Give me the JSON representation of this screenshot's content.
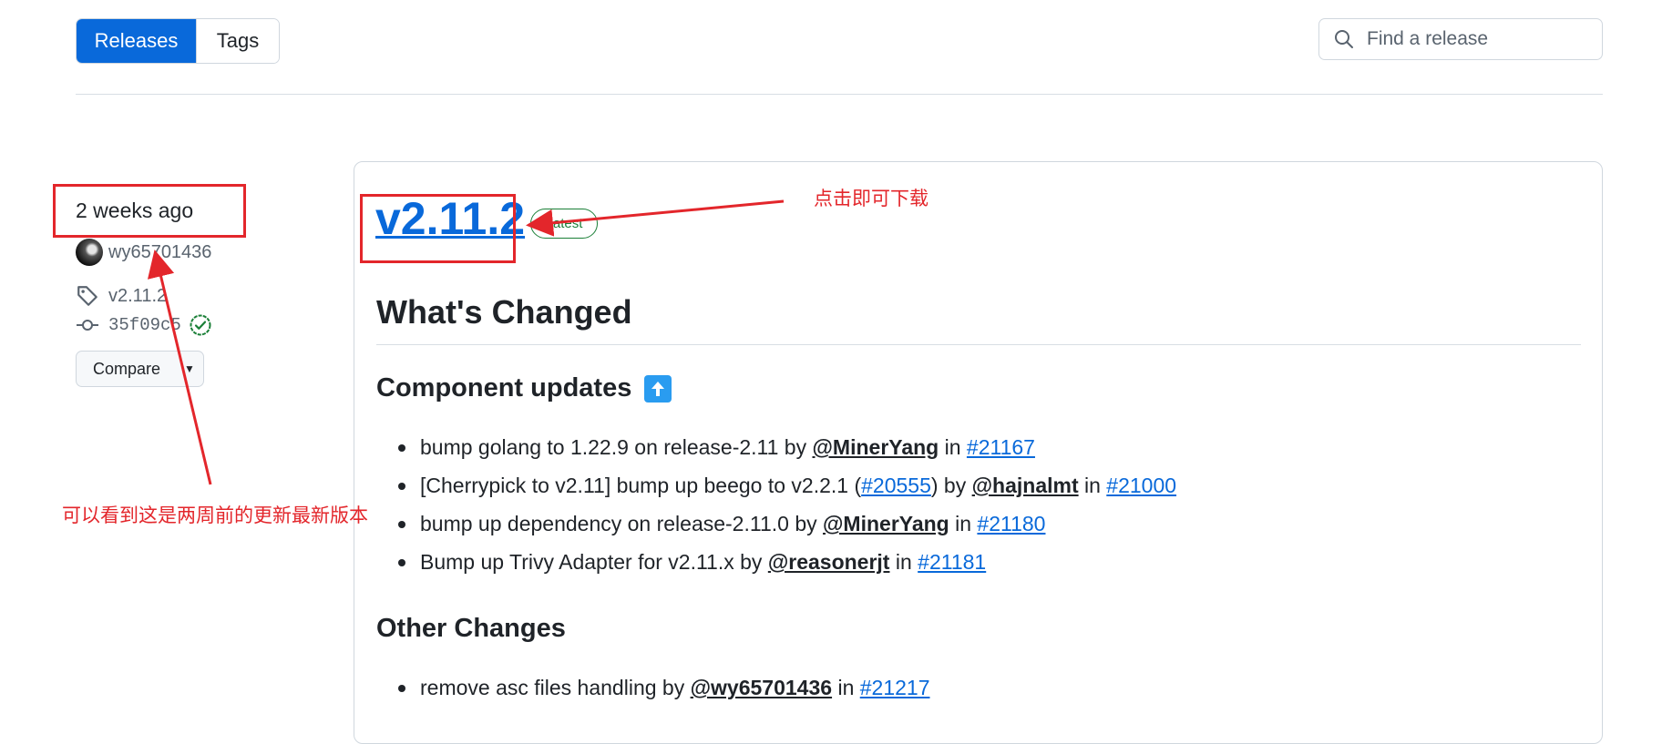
{
  "nav": {
    "tabs": [
      {
        "label": "Releases",
        "active": true
      },
      {
        "label": "Tags",
        "active": false
      }
    ],
    "search_placeholder": "Find a release"
  },
  "release_meta": {
    "when": "2 weeks ago",
    "author": "wy65701436",
    "tag": "v2.11.2",
    "commit": "35f09c5",
    "compare_label": "Compare"
  },
  "release": {
    "title": "v2.11.2",
    "badge": "Latest",
    "heading": "What's Changed",
    "sections": [
      {
        "title": "Component updates",
        "items": [
          {
            "prefix": "bump golang to 1.22.9 on release-2.11 by ",
            "user": "@MinerYang",
            "mid": " in ",
            "pr": "#21167"
          },
          {
            "prefix": "[Cherrypick to v2.11] bump up beego to v2.2.1 (",
            "link": "#20555",
            "after_link": ") by ",
            "user": "@hajnalmt",
            "mid": " in ",
            "pr": "#21000"
          },
          {
            "prefix": "bump up dependency on release-2.11.0 by ",
            "user": "@MinerYang",
            "mid": " in ",
            "pr": "#21180"
          },
          {
            "prefix": "Bump up Trivy Adapter for v2.11.x by ",
            "user": "@reasonerjt",
            "mid": " in ",
            "pr": "#21181"
          }
        ]
      },
      {
        "title": "Other Changes",
        "items": [
          {
            "prefix": "remove asc files handling by ",
            "user": "@wy65701436",
            "mid": " in ",
            "pr": "#21217"
          }
        ]
      }
    ]
  },
  "annotations": {
    "download_note": "点击即可下载",
    "latest_note": "可以看到这是两周前的更新最新版本",
    "color": "#e3262b"
  },
  "colors": {
    "accent": "#0969da",
    "success": "#1a7f37",
    "border": "#d0d7de",
    "text": "#1f2328",
    "muted": "#59636e"
  }
}
